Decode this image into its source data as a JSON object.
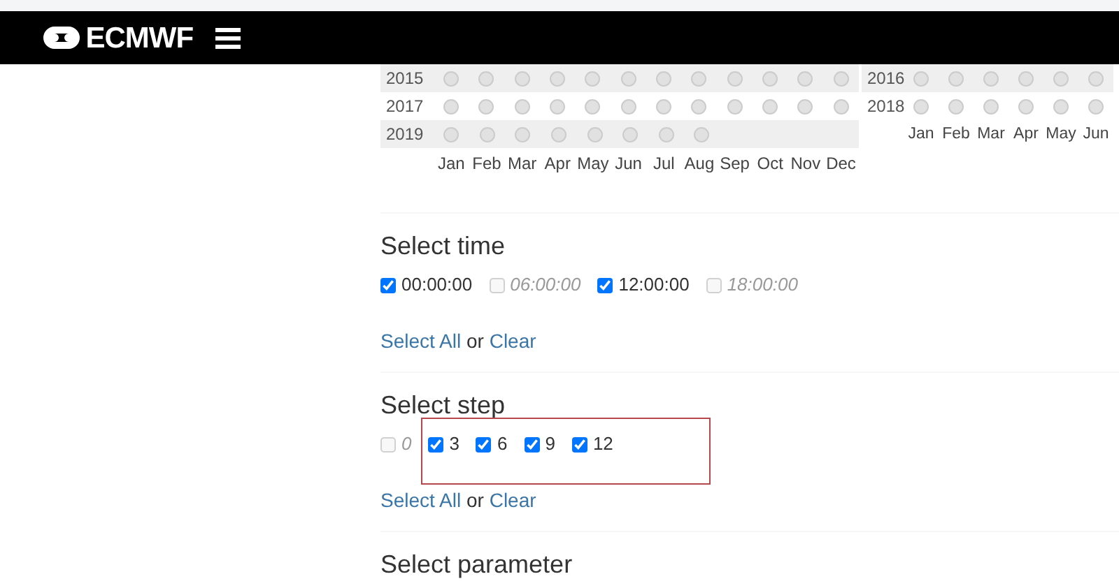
{
  "navbar": {
    "logo": "ECMWF"
  },
  "dates": {
    "panels": [
      {
        "years": [
          {
            "year": "2015",
            "shaded": true,
            "months": [
              {
                "selected": false
              },
              {
                "selected": false
              },
              {
                "selected": false
              },
              {
                "selected": false
              },
              {
                "selected": false
              },
              {
                "selected": false
              },
              {
                "selected": false
              },
              {
                "selected": false
              },
              {
                "selected": false
              },
              {
                "selected": false
              },
              {
                "selected": false
              },
              {
                "selected": false
              }
            ]
          },
          {
            "year": "2017",
            "shaded": false,
            "months": [
              {
                "selected": false
              },
              {
                "selected": false
              },
              {
                "selected": false
              },
              {
                "selected": false
              },
              {
                "selected": false
              },
              {
                "selected": false
              },
              {
                "selected": false
              },
              {
                "selected": false
              },
              {
                "selected": false
              },
              {
                "selected": false
              },
              {
                "selected": false
              },
              {
                "selected": false
              }
            ]
          },
          {
            "year": "2019",
            "shaded": true,
            "months": [
              {
                "selected": false
              },
              {
                "selected": false
              },
              {
                "selected": false
              },
              {
                "selected": false
              },
              {
                "selected": false
              },
              {
                "selected": false
              },
              {
                "selected": false
              },
              {
                "selected": false
              }
            ]
          }
        ],
        "month_labels": [
          "Jan",
          "Feb",
          "Mar",
          "Apr",
          "May",
          "Jun",
          "Jul",
          "Aug",
          "Sep",
          "Oct",
          "Nov",
          "Dec"
        ]
      },
      {
        "years": [
          {
            "year": "2016",
            "shaded": true,
            "months": [
              {
                "selected": false
              },
              {
                "selected": false
              },
              {
                "selected": false
              },
              {
                "selected": false
              },
              {
                "selected": false
              },
              {
                "selected": false
              }
            ]
          },
          {
            "year": "2018",
            "shaded": false,
            "months": [
              {
                "selected": false
              },
              {
                "selected": false
              },
              {
                "selected": false
              },
              {
                "selected": false
              },
              {
                "selected": false
              },
              {
                "selected": false
              }
            ]
          }
        ],
        "month_labels": [
          "Jan",
          "Feb",
          "Mar",
          "Apr",
          "May",
          "Jun"
        ]
      }
    ]
  },
  "sections": [
    {
      "title": "Select time",
      "options": [
        {
          "label": "00:00:00",
          "checked": true,
          "disabled": false
        },
        {
          "label": "06:00:00",
          "checked": false,
          "disabled": true
        },
        {
          "label": "12:00:00",
          "checked": true,
          "disabled": false
        },
        {
          "label": "18:00:00",
          "checked": false,
          "disabled": true
        }
      ],
      "select_all": "Select All",
      "joiner": "or",
      "clear": "Clear"
    },
    {
      "title": "Select step",
      "highlighted": true,
      "options": [
        {
          "label": "0",
          "checked": false,
          "disabled": true
        },
        {
          "label": "3",
          "checked": true,
          "disabled": false
        },
        {
          "label": "6",
          "checked": true,
          "disabled": false
        },
        {
          "label": "9",
          "checked": true,
          "disabled": false
        },
        {
          "label": "12",
          "checked": true,
          "disabled": false
        }
      ],
      "select_all": "Select All",
      "joiner": "or",
      "clear": "Clear"
    },
    {
      "title": "Select parameter"
    }
  ]
}
